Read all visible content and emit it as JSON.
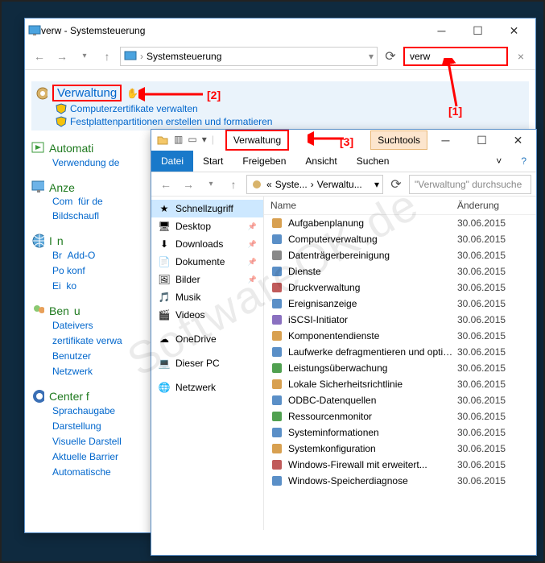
{
  "window1": {
    "title": "verw - Systemsteuerung",
    "breadcrumb_root": "Systemsteuerung",
    "search_value": "verw",
    "clear_icon": "×",
    "results": {
      "verwaltung": {
        "title": "Verwaltung",
        "sub1": "Computerzertifikate verwalten",
        "sub2": "Festplattenpartitionen erstellen und formatieren"
      },
      "automatic": {
        "title": "Automati",
        "sub1": "Verwendung de"
      },
      "anzeige": {
        "title": "Anze",
        "sub1": "Com",
        "sub2": "Bildsch"
      },
      "internet": {
        "title": "I",
        "sub1": "Br",
        "sub2": "Po",
        "sub3": "Ei"
      },
      "benutzer": {
        "title": "Ben",
        "sub1": "Dateivers",
        "sub2": "zertifikate verwa",
        "sub3": "Benutzer",
        "sub4": "Netzwerk"
      },
      "center": {
        "title": "Center f",
        "sub1": "Sprachau",
        "sub2": "Darstellung",
        "sub3": "Visuelle Darstell",
        "sub4": "Aktuelle Barrier",
        "sub5": "Automatische"
      }
    }
  },
  "window2": {
    "title_tab": "Verwaltung",
    "search_tools": "Suchtools",
    "ribbon": {
      "file": "Datei",
      "start": "Start",
      "share": "Freigeben",
      "view": "Ansicht",
      "search": "Suchen"
    },
    "breadcrumb": {
      "seg1": "Syste...",
      "seg2": "Verwaltu..."
    },
    "search_placeholder": "\"Verwaltung\" durchsuche",
    "columns": {
      "name": "Name",
      "date": "Änderung"
    },
    "sidebar": [
      {
        "label": "Schnellzugriff",
        "icon": "★",
        "sel": true
      },
      {
        "label": "Desktop",
        "icon": "🖥",
        "pin": true
      },
      {
        "label": "Downloads",
        "icon": "⬇",
        "pin": true
      },
      {
        "label": "Dokumente",
        "icon": "📄",
        "pin": true
      },
      {
        "label": "Bilder",
        "icon": "🖼",
        "pin": true
      },
      {
        "label": "Musik",
        "icon": "🎵"
      },
      {
        "label": "Videos",
        "icon": "🎬"
      },
      {
        "label": "OneDrive",
        "icon": "☁"
      },
      {
        "label": "Dieser PC",
        "icon": "💻"
      },
      {
        "label": "Netzwerk",
        "icon": "🌐"
      }
    ],
    "files": [
      {
        "name": "Aufgabenplanung",
        "date": "30.06.2015"
      },
      {
        "name": "Computerverwaltung",
        "date": "30.06.2015"
      },
      {
        "name": "Datenträgerbereinigung",
        "date": "30.06.2015"
      },
      {
        "name": "Dienste",
        "date": "30.06.2015"
      },
      {
        "name": "Druckverwaltung",
        "date": "30.06.2015"
      },
      {
        "name": "Ereignisanzeige",
        "date": "30.06.2015"
      },
      {
        "name": "iSCSI-Initiator",
        "date": "30.06.2015"
      },
      {
        "name": "Komponentendienste",
        "date": "30.06.2015"
      },
      {
        "name": "Laufwerke defragmentieren und optimier...",
        "date": "30.06.2015"
      },
      {
        "name": "Leistungsüberwachung",
        "date": "30.06.2015"
      },
      {
        "name": "Lokale Sicherheitsrichtlinie",
        "date": "30.06.2015"
      },
      {
        "name": "ODBC-Datenquellen",
        "date": "30.06.2015"
      },
      {
        "name": "Ressourcenmonitor",
        "date": "30.06.2015"
      },
      {
        "name": "Systeminformationen",
        "date": "30.06.2015"
      },
      {
        "name": "Systemkonfiguration",
        "date": "30.06.2015"
      },
      {
        "name": "Windows-Firewall mit erweitert...",
        "date": "30.06.2015"
      },
      {
        "name": "Windows-Speicherdiagnose",
        "date": "30.06.2015"
      }
    ]
  },
  "annotations": {
    "a1": "[1]",
    "a2": "[2]",
    "a3": "[3]"
  },
  "watermark": "SoftwareOK.de"
}
